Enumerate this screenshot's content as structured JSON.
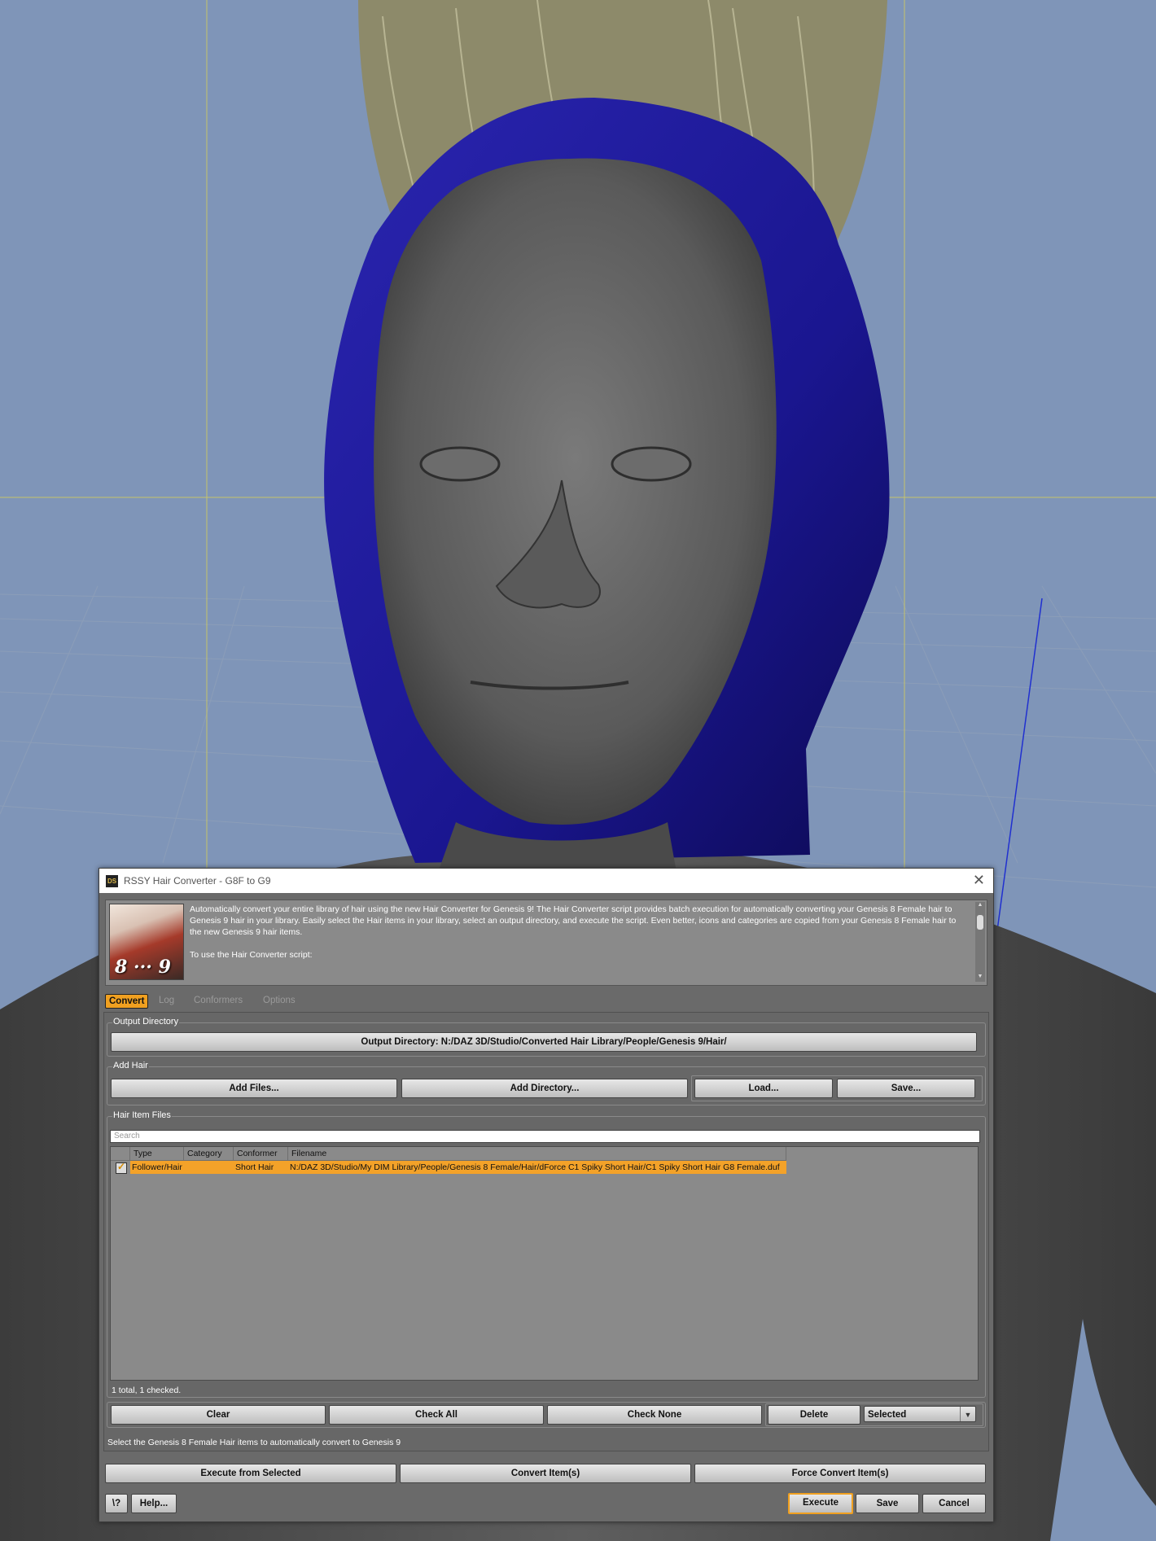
{
  "dialog": {
    "title": "RSSY Hair Converter - G8F to G9",
    "app_icon_text": "DS",
    "close_glyph": "✕",
    "description": {
      "image_caption": "8 ··· 9",
      "paragraph1": "Automatically convert your entire library of hair using the new Hair Converter for Genesis 9!  The Hair Converter script provides batch execution for automatically converting your Genesis 8 Female hair to Genesis 9 hair in your library.  Easily select the Hair items in your library, select an output directory, and execute the script.  Even better, icons and categories are copied from your Genesis 8 Female hair to the new Genesis 9 hair items.",
      "paragraph2": "To use the Hair Converter script:"
    },
    "tabs": [
      "Convert",
      "Log",
      "Conformers",
      "Options"
    ],
    "output_directory": {
      "group_label": "Output Directory",
      "button_label": "Output Directory: N:/DAZ 3D/Studio/Converted Hair Library/People/Genesis 9/Hair/"
    },
    "add_hair": {
      "group_label": "Add Hair",
      "add_files_label": "Add Files...",
      "add_directory_label": "Add Directory...",
      "load_label": "Load...",
      "save_label": "Save..."
    },
    "hair_item_files": {
      "group_label": "Hair Item Files",
      "search_placeholder": "Search",
      "columns": [
        "Type",
        "Category",
        "Conformer",
        "Filename"
      ],
      "rows": [
        {
          "checked": true,
          "type": "Follower/Hair",
          "category": "",
          "conformer": "Short Hair",
          "filename": "N:/DAZ 3D/Studio/My DIM Library/People/Genesis 8 Female/Hair/dForce C1 Spiky Short Hair/C1 Spiky Short Hair G8 Female.duf"
        }
      ],
      "count_text": "1 total, 1 checked."
    },
    "list_actions": {
      "clear_label": "Clear",
      "check_all_label": "Check All",
      "check_none_label": "Check None",
      "delete_label": "Delete",
      "selection_mode": "Selected"
    },
    "status_text": "Select the Genesis 8 Female Hair items to automatically convert to Genesis 9",
    "run_actions": {
      "execute_from_selected_label": "Execute from Selected",
      "convert_items_label": "Convert Item(s)",
      "force_convert_items_label": "Force Convert Item(s)"
    },
    "footer": {
      "whats_this_label": "\\?",
      "help_label": "Help...",
      "execute_label": "Execute",
      "save_label": "Save",
      "cancel_label": "Cancel"
    },
    "colors": {
      "accent": "#f0a020",
      "viewport_bg": "#7f95b8",
      "scarf": "#1d1a8c"
    }
  }
}
